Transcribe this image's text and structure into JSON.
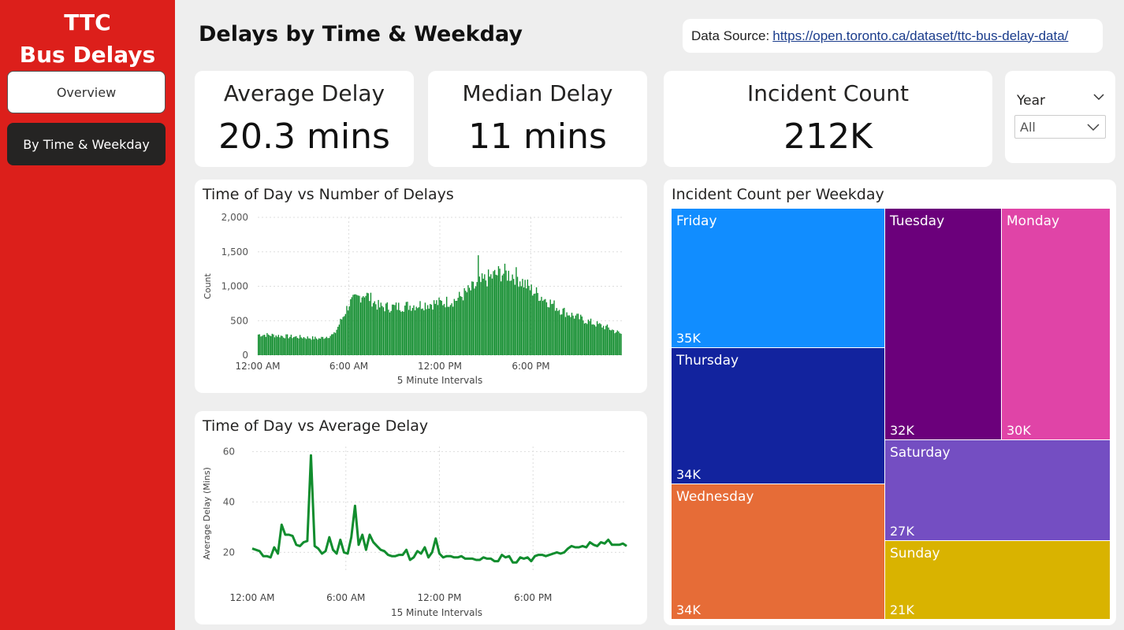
{
  "sidebar": {
    "brand_line1": "TTC",
    "brand_line2": "Bus Delays",
    "nav": [
      {
        "label": "Overview",
        "active": false
      },
      {
        "label": "By Time & Weekday",
        "active": true
      }
    ]
  },
  "header": {
    "title": "Delays by Time & Weekday",
    "source_label": "Data Source:",
    "source_link": "https://open.toronto.ca/dataset/ttc-bus-delay-data/"
  },
  "kpis": [
    {
      "label": "Average Delay",
      "value": "20.3 mins"
    },
    {
      "label": "Median Delay",
      "value": "11 mins"
    },
    {
      "label": "Incident Count",
      "value": "212K"
    }
  ],
  "slicer": {
    "title": "Year",
    "selected": "All"
  },
  "colors": {
    "sidebar": "#dc1f1b",
    "bars": "#118d2e",
    "line": "#118d2e",
    "active_nav": "#252423"
  },
  "icons": {
    "slicer_collapse": "chevron-down-icon",
    "dropdown": "chevron-down-icon"
  },
  "chart_data": [
    {
      "type": "bar",
      "title": "Time of Day vs Number of Delays",
      "xlabel": "5 Minute Intervals",
      "ylabel": "Count",
      "ylim": [
        0,
        2000
      ],
      "yticks": [
        "0",
        "500",
        "1,000",
        "1,500",
        "2,000"
      ],
      "xticks": [
        "12:00 AM",
        "6:00 AM",
        "12:00 PM",
        "6:00 PM"
      ],
      "grid": true,
      "hourly_profile": [
        300,
        290,
        270,
        260,
        240,
        300,
        750,
        900,
        700,
        700,
        720,
        740,
        760,
        800,
        950,
        1100,
        1200,
        1150,
        950,
        800,
        650,
        550,
        470,
        400
      ],
      "peak": 1450
    },
    {
      "type": "line",
      "title": "Time of Day vs Average Delay",
      "xlabel": "15 Minute Intervals",
      "ylabel": "Average Delay (Mins)",
      "ylim": [
        12,
        62
      ],
      "yticks": [
        "20",
        "40",
        "60"
      ],
      "xticks": [
        "12:00 AM",
        "6:00 AM",
        "12:00 PM",
        "6:00 PM"
      ],
      "grid": true,
      "values": [
        21.5,
        21,
        20.5,
        18.5,
        18.5,
        18,
        22,
        19.5,
        31,
        27,
        27,
        26.5,
        23,
        22.5,
        24,
        24.5,
        58.5,
        22.5,
        21.5,
        19.5,
        20.5,
        26,
        21,
        19.5,
        25,
        20,
        19.5,
        26,
        38.5,
        23,
        27,
        21,
        27,
        24,
        22.5,
        21,
        20.5,
        19,
        18.5,
        18.5,
        19,
        19,
        21,
        17,
        18,
        20.5,
        19.5,
        22,
        18,
        20,
        25.5,
        19.5,
        18,
        18.5,
        18.5,
        18,
        18,
        18.5,
        17.5,
        17.5,
        17.5,
        17,
        17,
        18,
        17.5,
        17.5,
        16.5,
        16.5,
        19,
        18,
        18.5,
        16,
        16,
        18,
        17.5,
        18,
        16.5,
        18.5,
        19,
        19,
        18.5,
        19,
        19.5,
        20,
        19.5,
        20,
        21.5,
        22.5,
        22,
        22,
        22.5,
        22,
        24,
        23,
        22.5,
        24,
        23.5,
        25,
        23,
        23,
        23,
        23.5,
        22.5
      ],
      "series": [
        {
          "name": "",
          "color": "#118d2e"
        }
      ]
    },
    {
      "type": "treemap",
      "title": "Incident Count per Weekday",
      "items": [
        {
          "name": "Friday",
          "value": "35K",
          "count": 35,
          "color": "#118dff"
        },
        {
          "name": "Thursday",
          "value": "34K",
          "count": 34,
          "color": "#12239e"
        },
        {
          "name": "Wednesday",
          "value": "34K",
          "count": 34,
          "color": "#e66c37"
        },
        {
          "name": "Tuesday",
          "value": "32K",
          "count": 32,
          "color": "#6b007b"
        },
        {
          "name": "Monday",
          "value": "30K",
          "count": 30,
          "color": "#e044a7"
        },
        {
          "name": "Saturday",
          "value": "27K",
          "count": 27,
          "color": "#744ec2"
        },
        {
          "name": "Sunday",
          "value": "21K",
          "count": 21,
          "color": "#d9b300"
        }
      ]
    }
  ]
}
